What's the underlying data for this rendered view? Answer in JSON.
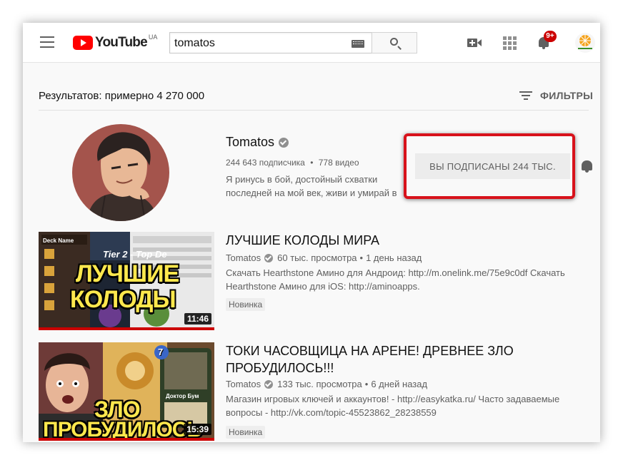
{
  "header": {
    "logo_text": "YouTube",
    "logo_region": "UA",
    "search_value": "tomatos",
    "notification_badge": "9+"
  },
  "results": {
    "count_text": "Результатов: примерно 4 270 000",
    "filters_label": "ФИЛЬТРЫ"
  },
  "channel": {
    "name": "Tomatos",
    "subscribers": "244 643 подписчика",
    "separator": "•",
    "videos": "778 видео",
    "description": "Я ринусь в бой, достойный схватки последней на мой век, живи и умирай в",
    "subscribe_label": "ВЫ ПОДПИСАНЫ  244 ТЫС."
  },
  "videos": [
    {
      "title": "ЛУЧШИЕ КОЛОДЫ МИРА",
      "channel": "Tomatos",
      "views": "60 тыс. просмотра",
      "separator": "•",
      "age": "1 день назад",
      "description": "Скачать Hearthstone Амино для Андроид: http://m.onelink.me/75e9c0df Скачать Hearthstone Амино для iOS: http://aminoapps.",
      "badge": "Новинка",
      "duration": "11:46",
      "thumb_line1": "ЛУЧШИЕ",
      "thumb_line2": "КОЛОДЫ",
      "thumb_header": "Tier 2 - Top De",
      "thumb_deck_label": "Deck Name"
    },
    {
      "title": "ТОКИ ЧАСОВЩИЦА НА АРЕНЕ! ДРЕВНЕЕ ЗЛО ПРОБУДИЛОСЬ!!!",
      "channel": "Tomatos",
      "views": "133 тыс. просмотра",
      "separator": "•",
      "age": "6 дней назад",
      "description": "Магазин игровых ключей и аккаунтов! - http://easykatka.ru/ Часто задаваемые вопросы - http://vk.com/topic-45523862_28238559",
      "badge": "Новинка",
      "duration": "15:39",
      "thumb_line1": "ЗЛО",
      "thumb_line2": "ПРОБУДИЛОСЬ",
      "thumb_card_cost": "7",
      "thumb_card_name": "Доктор Бум"
    }
  ],
  "colors": {
    "brand_red": "#ff0000",
    "highlight_red": "#d8121b",
    "text_primary": "#111111",
    "text_secondary": "#606060"
  }
}
